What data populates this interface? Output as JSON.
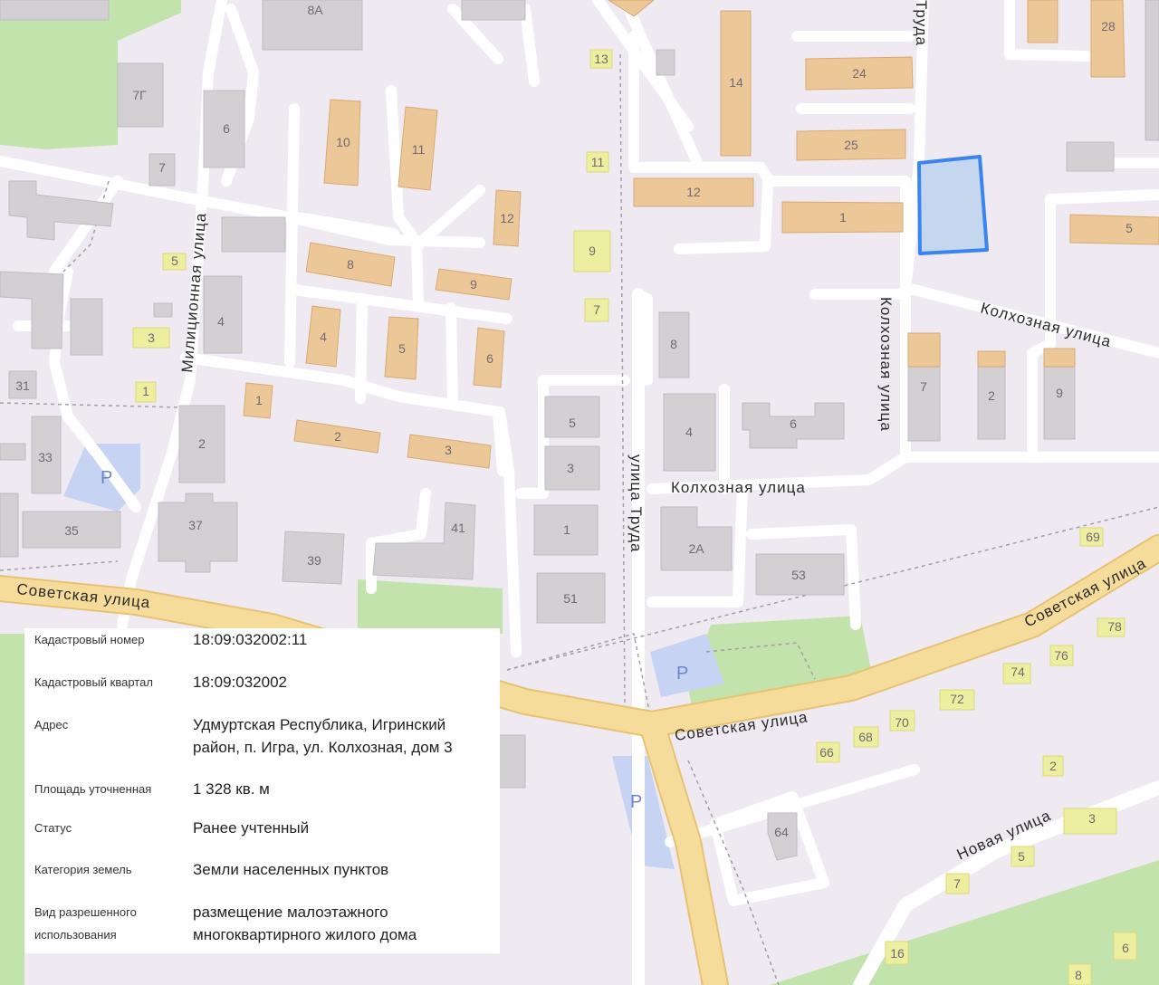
{
  "colors": {
    "background": "#efeaf2",
    "road": "#ffffff",
    "major_road": "#f6dc9a",
    "major_road_edge": "#e7c273",
    "building_gray": "#d2d0d3",
    "building_orange": "#ecc899",
    "building_orange_edge": "#d7a971",
    "building_yellow": "#eeeea0",
    "park": "#c3e3ad",
    "parking": "#c7d3f3",
    "parcel_fill": "#c5d6ef",
    "parcel_stroke": "#3a84ef"
  },
  "streets": {
    "truda_top": "Труда",
    "militsionnaya": "Милиционная улица",
    "kolkhoznaya_ne": "Колхозная улица",
    "kolkhoznaya_v": "Колхозная улица",
    "kolkhoznaya_mid": "Колхозная улица",
    "truda_v": "улица Труда",
    "sovetskaya_w": "Советская улица",
    "sovetskaya_mid": "Советская улица",
    "sovetskaya_e": "Советская улица",
    "novaya": "Новая улица"
  },
  "buildings": {
    "b8a": "8А",
    "b7g": "7Г",
    "b6w": "6",
    "b7w": "7",
    "b5w": "5",
    "b4w": "4",
    "b3w": "3",
    "b31": "31",
    "b1w": "1",
    "b33": "33",
    "b35": "35",
    "b2w": "2",
    "b37": "37",
    "b39": "39",
    "b41": "41",
    "b10": "10",
    "b11": "11",
    "b12a": "12",
    "b8o": "8",
    "b9o": "9",
    "b4o": "4",
    "b5o": "5",
    "b6o": "6",
    "b1o": "1",
    "b2o": "2",
    "b3o": "3",
    "b13": "13",
    "b11y": "11",
    "b9y": "9",
    "b7y": "7",
    "b14": "14",
    "b12b": "12",
    "b24": "24",
    "b25": "25",
    "b1n": "1",
    "b28": "28",
    "b5e": "5",
    "b8g": "8",
    "b4g": "4",
    "b6g": "6",
    "b7k": "7",
    "b2k": "2",
    "b9k": "9",
    "b5g": "5",
    "b3g": "3",
    "b1g": "1",
    "b51": "51",
    "b2a": "2А",
    "b53": "53",
    "b69": "69",
    "b78": "78",
    "b76": "76",
    "b74": "74",
    "b72": "72",
    "b70": "70",
    "b68": "68",
    "b66": "66",
    "b2s": "2",
    "b3s": "3",
    "b5s": "5",
    "b7s": "7",
    "b64": "64",
    "b16": "16",
    "b8s": "8",
    "b6s": "6"
  },
  "parking_label": "P",
  "info": [
    {
      "key": "Кадастровый номер",
      "value": "18:09:032002:11"
    },
    {
      "key": "Кадастровый квартал",
      "value": "18:09:032002"
    },
    {
      "key": "Адрес",
      "value": "Удмуртская Республика, Игринский район, п. Игра, ул. Колхозная, дом 3"
    },
    {
      "key": "Площадь уточненная",
      "value": "1 328 кв. м"
    },
    {
      "key": "Статус",
      "value": "Ранее учтенный"
    },
    {
      "key": "Категория земель",
      "value": "Земли населенных пунктов"
    },
    {
      "key": "Вид разрешенного использования",
      "value": "размещение малоэтажного многоквартирного жилого дома"
    }
  ]
}
